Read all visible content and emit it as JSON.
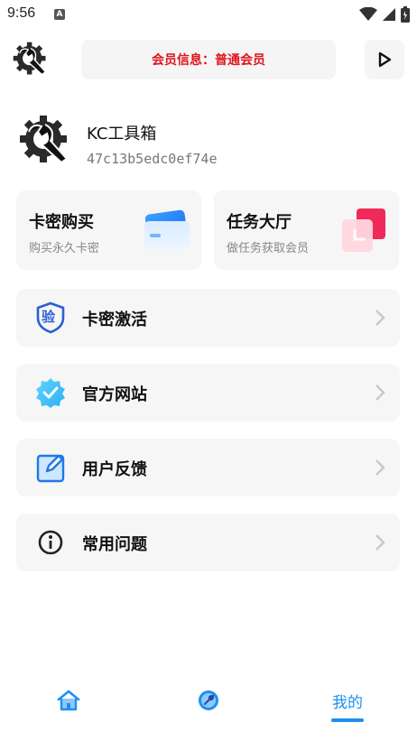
{
  "status_bar": {
    "time": "9:56",
    "notification_letter": "A"
  },
  "header": {
    "member_info": "会员信息：普通会员"
  },
  "profile": {
    "name": "KC工具箱",
    "id": "47c13b5edc0ef74e"
  },
  "cards": [
    {
      "title": "卡密购买",
      "subtitle": "购买永久卡密"
    },
    {
      "title": "任务大厅",
      "subtitle": "做任务获取会员"
    }
  ],
  "menu": [
    {
      "label": "卡密激活",
      "icon": "verify-shield-icon",
      "badge_char": "验"
    },
    {
      "label": "官方网站",
      "icon": "verified-badge-icon"
    },
    {
      "label": "用户反馈",
      "icon": "edit-note-icon"
    },
    {
      "label": "常用问题",
      "icon": "info-icon"
    }
  ],
  "bottom_nav": {
    "home_icon": "home-icon",
    "tools_icon": "wrench-icon",
    "mine_label": "我的"
  },
  "colors": {
    "accent": "#1e8ff0",
    "member_red": "#e0141e",
    "card_bg": "#f6f6f6"
  }
}
